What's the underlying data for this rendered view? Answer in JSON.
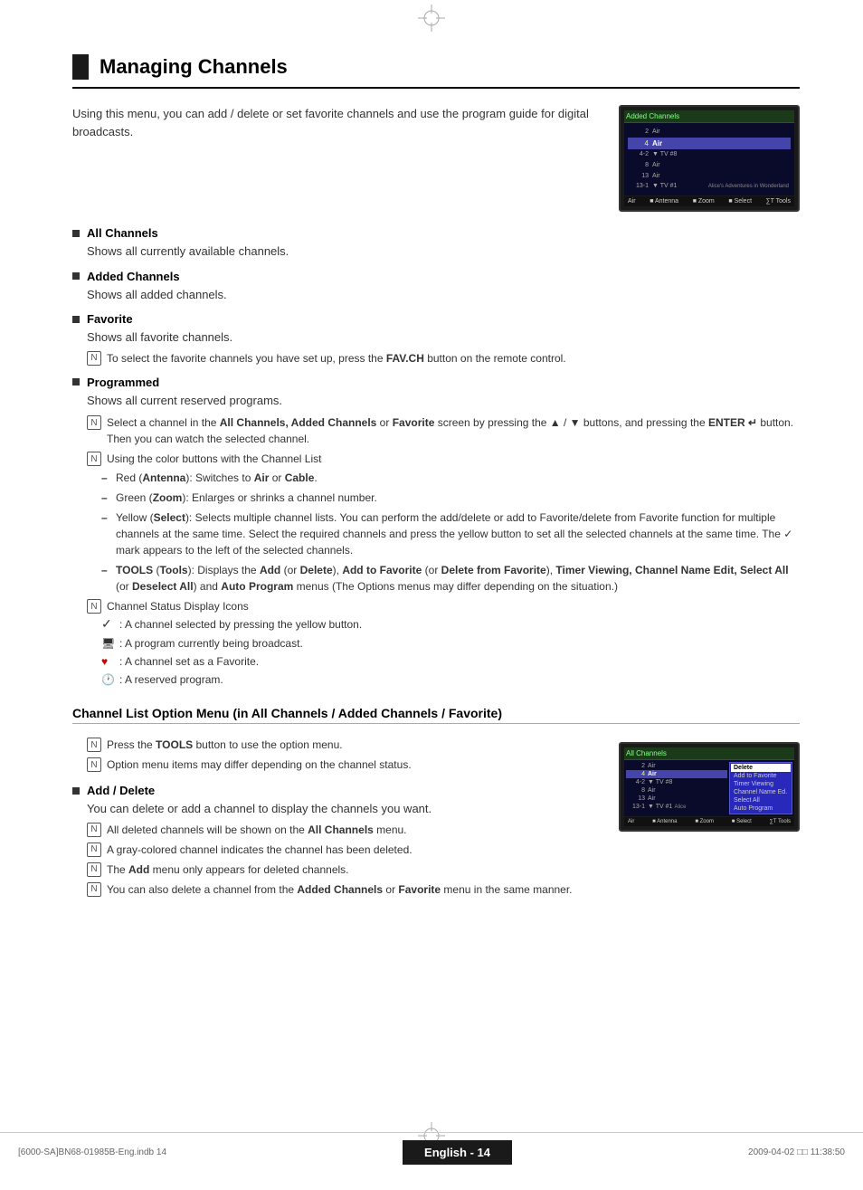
{
  "page": {
    "title": "Managing Channels",
    "footer_label": "English - 14",
    "footer_left": "[6000-SA]BN68-01985B-Eng.indb   14",
    "footer_right": "2009-04-02   □□   11:38:50"
  },
  "intro": {
    "text": "Using this menu, you can add / delete or set favorite channels and use the program guide for digital broadcasts."
  },
  "sections": [
    {
      "id": "all-channels",
      "heading": "All Channels",
      "body": "Shows all currently available channels."
    },
    {
      "id": "added-channels",
      "heading": "Added Channels",
      "body": "Shows all added channels."
    },
    {
      "id": "favorite",
      "heading": "Favorite",
      "body": "Shows all favorite channels.",
      "note": "To select the favorite channels you have set up, press the FAV.CH button on the remote control."
    },
    {
      "id": "programmed",
      "heading": "Programmed",
      "body": "Shows all current reserved programs."
    }
  ],
  "notes": [
    {
      "id": "note1",
      "text": "Select a channel in the All Channels, Added Channels or Favorite screen by pressing the ▲ / ▼ buttons, and pressing the ENTER  button. Then you can watch the selected channel."
    },
    {
      "id": "note2",
      "text": "Using the color buttons with the Channel List"
    }
  ],
  "dash_items": [
    {
      "id": "red",
      "label": "Red (Antenna)",
      "text": ": Switches to Air or Cable."
    },
    {
      "id": "green",
      "label": "Green (Zoom)",
      "text": ": Enlarges or shrinks a channel number."
    },
    {
      "id": "yellow",
      "label": "Yellow (Select)",
      "text": ": Selects multiple channel lists. You can perform the add/delete or add to Favorite/delete from Favorite function for multiple channels at the same time. Select the required channels and press the yellow button to set all the selected channels at the same time. The ✓ mark appears to the left of the selected channels."
    },
    {
      "id": "tools",
      "label": "TOOLS (Tools)",
      "text": ": Displays the Add (or Delete), Add to Favorite (or Delete from Favorite), Timer Viewing, Channel Name Edit, Select All (or Deselect All) and Auto Program menus (The Options menus may differ depending on the situation.)"
    }
  ],
  "status_section": {
    "heading": "Channel Status Display Icons",
    "items": [
      {
        "symbol": "✓",
        "text": ": A channel selected by pressing the yellow button."
      },
      {
        "symbol": "📺",
        "text": ": A program currently being broadcast."
      },
      {
        "symbol": "♥",
        "text": ": A channel set as a Favorite."
      },
      {
        "symbol": "🕐",
        "text": ": A reserved program."
      }
    ]
  },
  "channel_list_section": {
    "heading": "Channel List Option Menu (in All Channels / Added Channels / Favorite)",
    "notes": [
      "Press the TOOLS button to use the option menu.",
      "Option menu items may differ depending on the channel status."
    ]
  },
  "add_delete_section": {
    "heading": "Add / Delete",
    "body": "You can delete or add a channel to display the channels you want.",
    "notes": [
      "All deleted channels will be shown on the All Channels menu.",
      "A gray-colored channel indicates the channel has been deleted.",
      "The Add menu only appears for deleted channels.",
      "You can also delete a channel from the Added Channels or Favorite menu in the same manner."
    ]
  },
  "tv_screen1": {
    "label": "Added Channels",
    "rows": [
      {
        "selected": false,
        "num": "2",
        "name": "Air",
        "extra": ""
      },
      {
        "selected": true,
        "num": "4",
        "name": "Air",
        "extra": ""
      },
      {
        "selected": false,
        "num": "4-2",
        "name": "▼ TV #8",
        "extra": ""
      },
      {
        "selected": false,
        "num": "8",
        "name": "Air",
        "extra": ""
      },
      {
        "selected": false,
        "num": "13",
        "name": "Air",
        "extra": ""
      },
      {
        "selected": false,
        "num": "13-1",
        "name": "▼ TV #1",
        "extra": "Alice's Adventures in Wonderland"
      }
    ],
    "bottom": "Air  ■ Antenna  ■ Zoom  ■ Select  ∑T Tools"
  },
  "tv_screen2": {
    "label": "All Channels",
    "rows": [
      {
        "selected": false,
        "num": "2",
        "name": "Air",
        "extra": ""
      },
      {
        "selected": true,
        "num": "4",
        "name": "Air",
        "extra": ""
      },
      {
        "selected": false,
        "num": "4-2",
        "name": "▼ TV #8",
        "extra": ""
      },
      {
        "selected": false,
        "num": "8",
        "name": "Air",
        "extra": ""
      },
      {
        "selected": false,
        "num": "13",
        "name": "Air",
        "extra": ""
      },
      {
        "selected": false,
        "num": "13-1",
        "name": "▼ TV #1",
        "extra": "Alice"
      }
    ],
    "menu_items": [
      {
        "text": "Delete",
        "selected": true
      },
      {
        "text": "Add to Favorite",
        "selected": false
      },
      {
        "text": "Timer Viewing",
        "selected": false
      },
      {
        "text": "Channel Name Ed.",
        "selected": false
      },
      {
        "text": "Select All",
        "selected": false
      },
      {
        "text": "Auto Program",
        "selected": false
      }
    ],
    "bottom": "Air  ■ Antenna  ■ Zoom  ■ Select  ∑T Tools"
  }
}
